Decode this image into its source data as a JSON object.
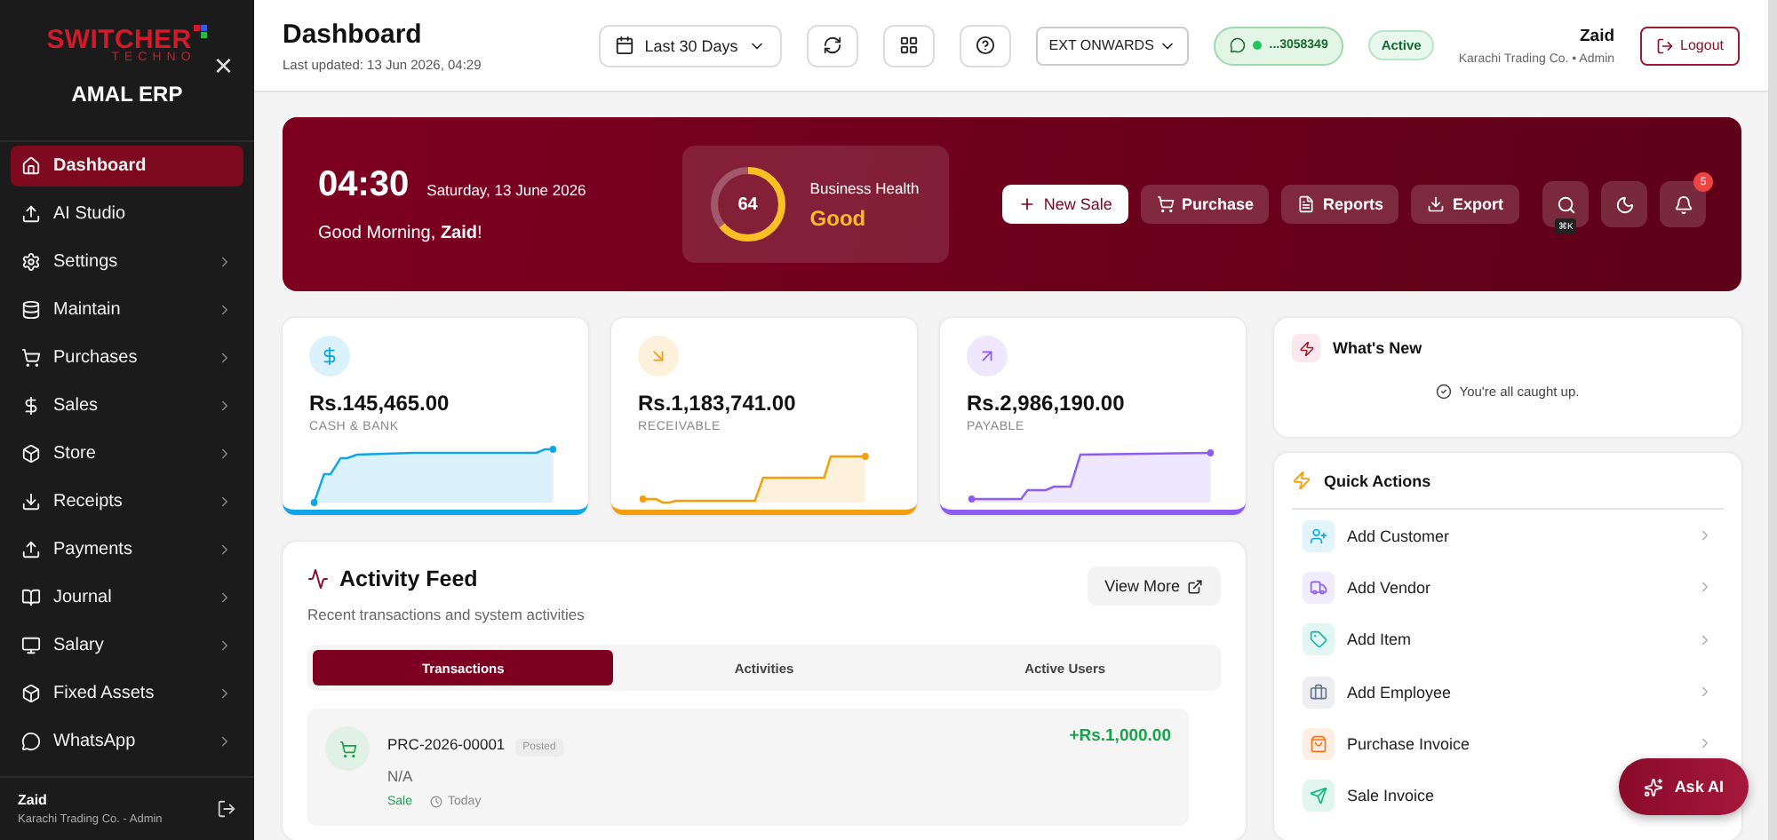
{
  "sidebar": {
    "logo": {
      "word": "SWITCHER",
      "sub": "TECHNO"
    },
    "app_name": "AMAL ERP",
    "close": "×",
    "items": [
      {
        "label": "Dashboard",
        "selected": true,
        "expandable": false
      },
      {
        "label": "AI Studio",
        "selected": false,
        "expandable": false
      },
      {
        "label": "Settings",
        "selected": false,
        "expandable": true
      },
      {
        "label": "Maintain",
        "selected": false,
        "expandable": true
      },
      {
        "label": "Purchases",
        "selected": false,
        "expandable": true
      },
      {
        "label": "Sales",
        "selected": false,
        "expandable": true
      },
      {
        "label": "Store",
        "selected": false,
        "expandable": true
      },
      {
        "label": "Receipts",
        "selected": false,
        "expandable": true
      },
      {
        "label": "Payments",
        "selected": false,
        "expandable": true
      },
      {
        "label": "Journal",
        "selected": false,
        "expandable": true
      },
      {
        "label": "Salary",
        "selected": false,
        "expandable": true
      },
      {
        "label": "Fixed Assets",
        "selected": false,
        "expandable": true
      },
      {
        "label": "WhatsApp",
        "selected": false,
        "expandable": true
      }
    ],
    "user": {
      "name": "Zaid",
      "org": "Karachi Trading Co. - Admin"
    }
  },
  "header": {
    "title": "Dashboard",
    "updated": "Last updated: 13 Jun 2026, 04:29",
    "range": "Last 30 Days",
    "company": "EXT ONWARDS",
    "whatsapp": "...3058349",
    "status": "Active",
    "user": "Zaid",
    "org": "Karachi Trading Co. • Admin",
    "logout": "Logout"
  },
  "banner": {
    "time": "04:30",
    "date": "Saturday, 13 June 2026",
    "greeting": "Good Morning, **Zaid**!",
    "health": {
      "score": "64",
      "level": 0.64,
      "label": "Business Health",
      "rating": "Good"
    },
    "actions": [
      {
        "label": "New Sale",
        "primary": true
      },
      {
        "label": "Purchase",
        "primary": false
      },
      {
        "label": "Reports",
        "primary": false
      },
      {
        "label": "Export",
        "primary": false
      }
    ],
    "shortcut": "⌘K",
    "notifications": "5"
  },
  "stats": [
    {
      "amount": "Rs.145,465.00",
      "label": "CASH & BANK",
      "color": "#0ea5e9"
    },
    {
      "amount": "Rs.1,183,741.00",
      "label": "RECEIVABLE",
      "color": "#f59e0b"
    },
    {
      "amount": "Rs.2,986,190.00",
      "label": "PAYABLE",
      "color": "#8b5cf6"
    }
  ],
  "activity": {
    "title": "Activity Feed",
    "subtitle": "Recent transactions and system activities",
    "view_more": "View More",
    "tabs": [
      {
        "label": "Transactions",
        "selected": true
      },
      {
        "label": "Activities",
        "selected": false
      },
      {
        "label": "Active Users",
        "selected": false
      }
    ],
    "rows": [
      {
        "ref": "PRC-2026-00001",
        "status": "Posted",
        "party": "N/A",
        "type": "Sale",
        "time": "Today",
        "amount": "+Rs.1,000.00"
      }
    ]
  },
  "whats_new": {
    "title": "What's New",
    "message": "You're all caught up."
  },
  "quick_actions": {
    "title": "Quick Actions",
    "items": [
      {
        "label": "Add Customer",
        "color": "#0ea5e9"
      },
      {
        "label": "Add Vendor",
        "color": "#8b5cf6"
      },
      {
        "label": "Add Item",
        "color": "#14b8a6"
      },
      {
        "label": "Add Employee",
        "color": "#64748b"
      },
      {
        "label": "Purchase Invoice",
        "color": "#f97316"
      },
      {
        "label": "Sale Invoice",
        "color": "#10b981"
      }
    ]
  },
  "ask_ai": "Ask AI"
}
